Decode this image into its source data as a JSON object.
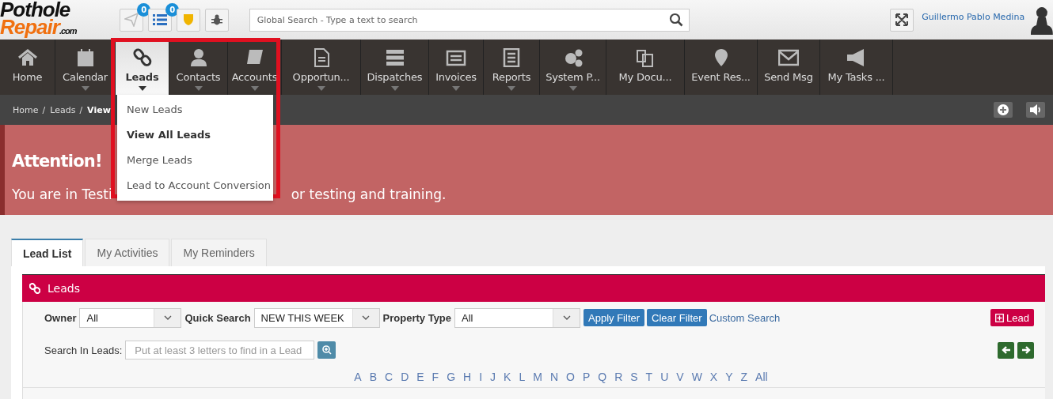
{
  "logo": {
    "line_1": "Pothole",
    "line_2": "Repair",
    "suffix": ".com"
  },
  "header": {
    "badges": [
      "0",
      "0"
    ],
    "search": {
      "placeholder": "Global Search - Type a text to search"
    },
    "user_name": "Guillermo Pablo Medina"
  },
  "nav": [
    {
      "label": "Home",
      "caret": false,
      "selected": false
    },
    {
      "label": "Calendar",
      "caret": true,
      "selected": false
    },
    {
      "label": "Leads",
      "caret": true,
      "selected": true
    },
    {
      "label": "Contacts",
      "caret": true,
      "selected": false
    },
    {
      "label": "Accounts",
      "caret": true,
      "selected": false
    },
    {
      "label": "Opportun...",
      "caret": true,
      "selected": false
    },
    {
      "label": "Dispatches",
      "caret": true,
      "selected": false
    },
    {
      "label": "Invoices",
      "caret": true,
      "selected": false
    },
    {
      "label": "Reports",
      "caret": true,
      "selected": false
    },
    {
      "label": "System P...",
      "caret": true,
      "selected": false
    },
    {
      "label": "My Docu...",
      "caret": false,
      "selected": false
    },
    {
      "label": "Event Res...",
      "caret": false,
      "selected": false
    },
    {
      "label": "Send Msg",
      "caret": false,
      "selected": false
    },
    {
      "label": "My Tasks ...",
      "caret": false,
      "selected": false
    }
  ],
  "breadcrumb": [
    {
      "label": "Home",
      "separator": "/"
    },
    {
      "label": "Leads",
      "separator": "/"
    },
    {
      "label": "View"
    }
  ],
  "dropdown": [
    {
      "label": "New Leads",
      "selected": false
    },
    {
      "label": "View All Leads",
      "selected": true
    },
    {
      "label": "Merge Leads",
      "selected": false
    },
    {
      "label": "Lead to Account Conversion",
      "selected": false
    }
  ],
  "alert": {
    "title": "Attention!",
    "text_start": "You are in Testi",
    "text_end": "or testing and training."
  },
  "tabs": [
    {
      "label": "Lead List",
      "selected": true
    },
    {
      "label": "My Activities",
      "selected": false
    },
    {
      "label": "My Reminders",
      "selected": false
    }
  ],
  "panel": {
    "title": "Leads",
    "filters": [
      {
        "label": "Owner",
        "value": "All"
      },
      {
        "label": "Quick Search",
        "value": "NEW THIS WEEK"
      },
      {
        "label": "Property Type",
        "value": "All"
      }
    ],
    "apply_button": "Apply Filter",
    "clear_button": "Clear Filter",
    "custom_search": "Custom Search",
    "add_button": "Lead",
    "search_label": "Search In Leads:",
    "search_placeholder": "Put at least 3 letters to find in a Lead",
    "letters": [
      "A",
      "B",
      "C",
      "D",
      "E",
      "F",
      "G",
      "H",
      "I",
      "J",
      "K",
      "L",
      "M",
      "N",
      "O",
      "P",
      "Q",
      "R",
      "S",
      "T",
      "U",
      "V",
      "W",
      "X",
      "Y",
      "Z",
      "All"
    ]
  }
}
